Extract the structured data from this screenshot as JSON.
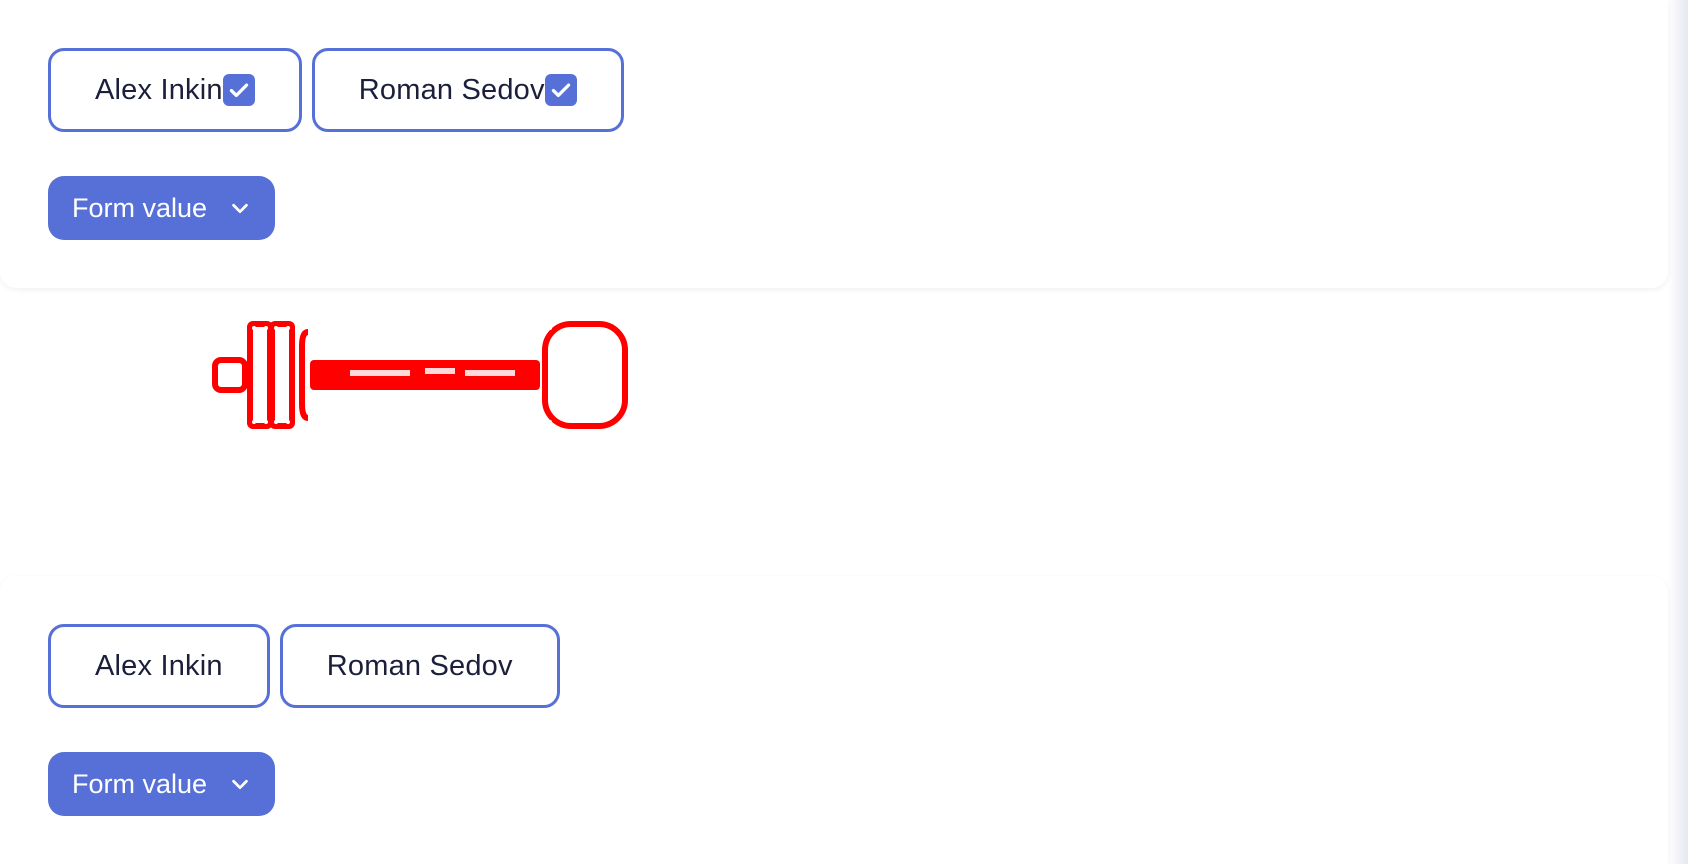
{
  "panels": [
    {
      "chips": [
        {
          "label": "Alex Inkin",
          "checked": true
        },
        {
          "label": "Roman Sedov",
          "checked": true
        }
      ],
      "dropdown_label": "Form value"
    },
    {
      "chips": [
        {
          "label": "Alex Inkin",
          "checked": false
        },
        {
          "label": "Roman Sedov",
          "checked": false
        }
      ],
      "dropdown_label": "Form value"
    }
  ],
  "icons": {
    "checkbox": "check-icon",
    "dropdown": "chevron-down-icon"
  },
  "colors": {
    "accent": "#5670d8",
    "text": "#1b1f3b",
    "glitch": "#ff0000",
    "background": "#ffffff"
  }
}
